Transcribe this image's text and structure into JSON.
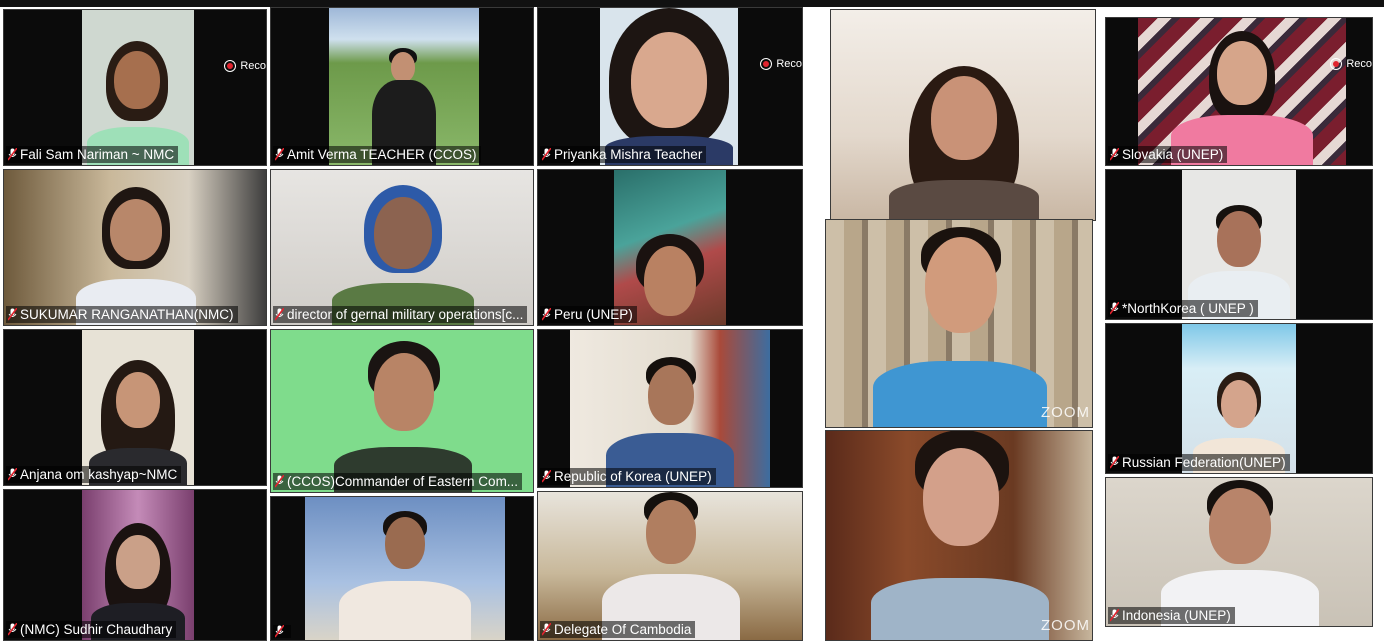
{
  "recording": {
    "label": "Reco"
  },
  "watermark": {
    "text": "ZOOM"
  },
  "mic_icon": "muted-microphone-icon",
  "participants": [
    {
      "label": "Fali Sam Nariman ~ NMC",
      "rec": true
    },
    {
      "label": "Amit Verma TEACHER (CCOS)"
    },
    {
      "label": "Priyanka Mishra Teacher",
      "rec": true
    },
    {
      "label": ""
    },
    {
      "label": "Slovakia  (UNEP)",
      "rec": true
    },
    {
      "label": "SUKUMAR RANGANATHAN(NMC)"
    },
    {
      "label": "director of gernal military operations[c..."
    },
    {
      "label": "Peru (UNEP)"
    },
    {
      "label": ""
    },
    {
      "label": "*NorthKorea ( UNEP )"
    },
    {
      "label": "Anjana om kashyap~NMC"
    },
    {
      "label": "(CCOS)Commander of Eastern Com..."
    },
    {
      "label": "Republic of Korea (UNEP)"
    },
    {
      "label": "Russian Federation(UNEP)"
    },
    {
      "label": "(NMC) Sudhir Chaudhary"
    },
    {
      "label": ""
    },
    {
      "label": "Delegate Of Cambodia"
    },
    {
      "label": ""
    },
    {
      "label": "Indonesia (UNEP)"
    }
  ],
  "colors": {
    "record_dot": "#e0232e",
    "tile_bg": "#0b0b0b"
  }
}
